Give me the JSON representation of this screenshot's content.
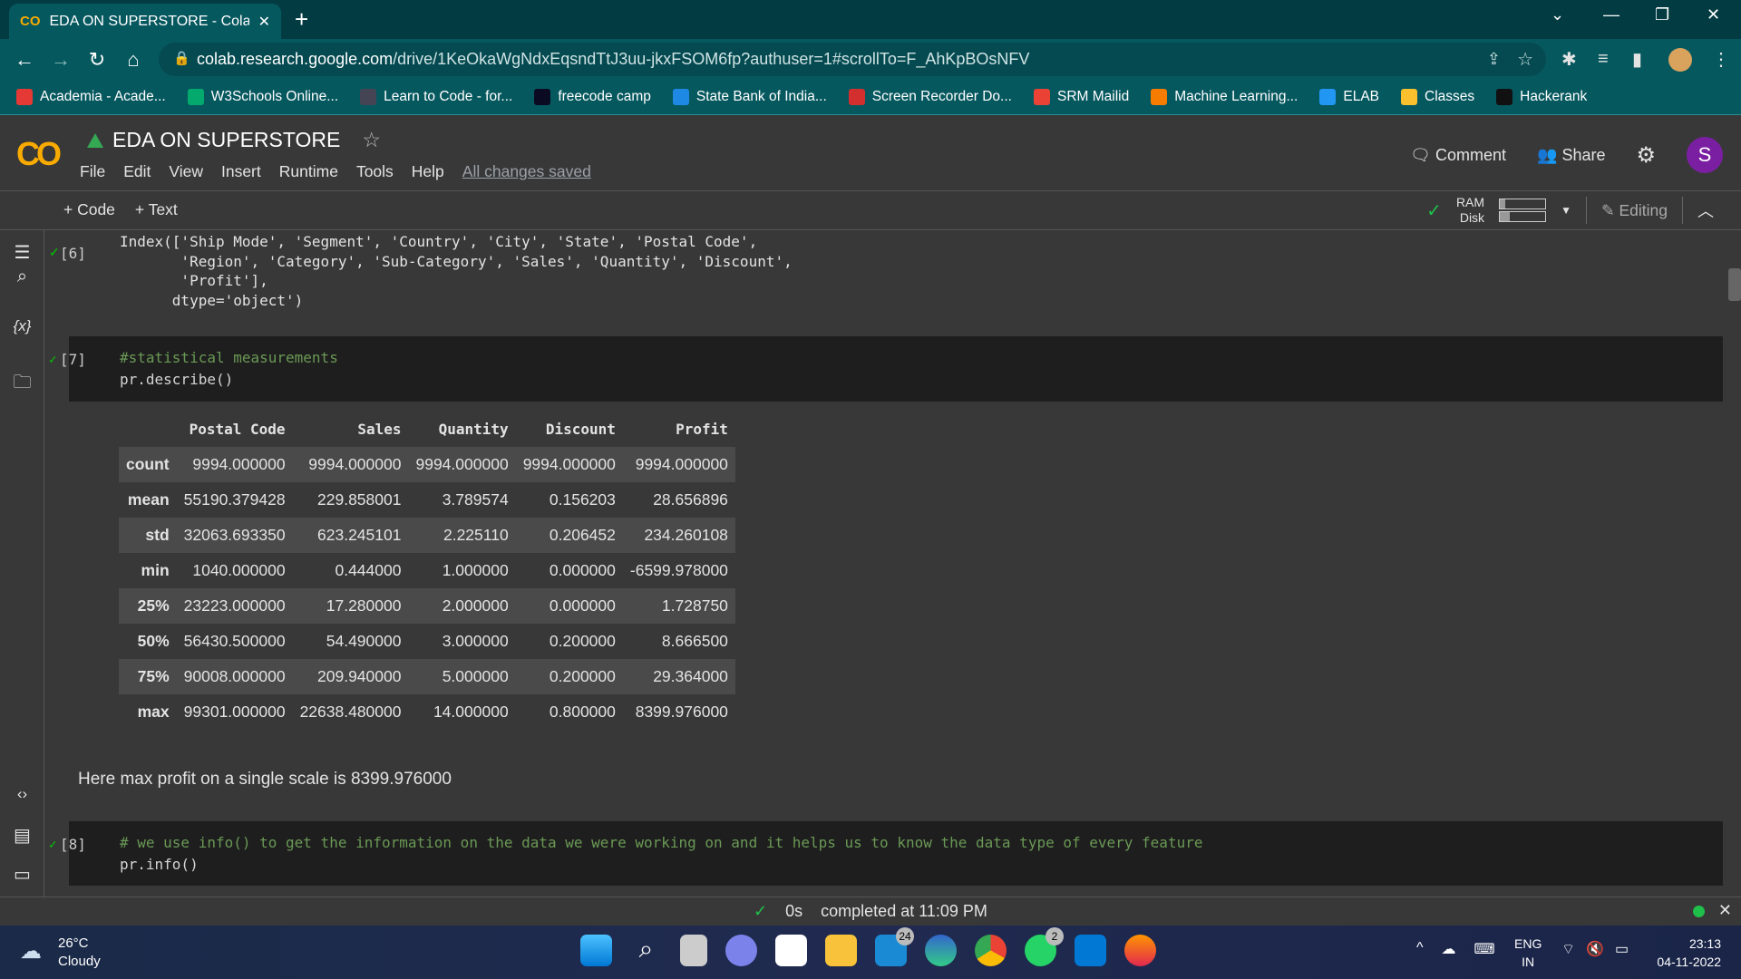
{
  "browser": {
    "tab_title": "EDA ON SUPERSTORE - Colaboratory",
    "url_host": "colab.research.google.com",
    "url_path": "/drive/1KeOkaWgNdxEqsndTtJ3uu-jkxFSOM6fp?authuser=1#scrollTo=F_AhKpBOsNFV",
    "bookmarks": [
      {
        "label": "Academia - Acade...",
        "color": "#e53935"
      },
      {
        "label": "W3Schools Online...",
        "color": "#04aa6d"
      },
      {
        "label": "Learn to Code - for...",
        "color": "#445"
      },
      {
        "label": "freecode camp",
        "color": "#0a0a23"
      },
      {
        "label": "State Bank of India...",
        "color": "#1e88e5"
      },
      {
        "label": "Screen Recorder Do...",
        "color": "#d32f2f"
      },
      {
        "label": "SRM Mailid",
        "color": "#ea4335"
      },
      {
        "label": "Machine Learning...",
        "color": "#f57c00"
      },
      {
        "label": "ELAB",
        "color": "#2196f3"
      },
      {
        "label": "Classes",
        "color": "#fbc02d"
      },
      {
        "label": "Hackerank",
        "color": "#111"
      }
    ]
  },
  "colab": {
    "logo": "CO",
    "title": "EDA ON SUPERSTORE",
    "menu": [
      "File",
      "Edit",
      "View",
      "Insert",
      "Runtime",
      "Tools",
      "Help"
    ],
    "saved": "All changes saved",
    "comment": "Comment",
    "share": "Share",
    "avatar": "S",
    "add_code": "+ Code",
    "add_text": "+ Text",
    "ram": "RAM",
    "disk": "Disk",
    "ram_usage": 0.12,
    "disk_usage": 0.22,
    "editing": "Editing",
    "accent": "#f9ab00"
  },
  "cells": {
    "c6": {
      "count": "[6]",
      "output": "Index(['Ship Mode', 'Segment', 'Country', 'City', 'State', 'Postal Code',\n       'Region', 'Category', 'Sub-Category', 'Sales', 'Quantity', 'Discount',\n       'Profit'],\n      dtype='object')"
    },
    "c7": {
      "count": "[7]",
      "comment": "#statistical measurements",
      "code": "pr.describe()"
    },
    "table": {
      "columns": [
        "",
        "Postal Code",
        "Sales",
        "Quantity",
        "Discount",
        "Profit"
      ],
      "rows": [
        [
          "count",
          "9994.000000",
          "9994.000000",
          "9994.000000",
          "9994.000000",
          "9994.000000"
        ],
        [
          "mean",
          "55190.379428",
          "229.858001",
          "3.789574",
          "0.156203",
          "28.656896"
        ],
        [
          "std",
          "32063.693350",
          "623.245101",
          "2.225110",
          "0.206452",
          "234.260108"
        ],
        [
          "min",
          "1040.000000",
          "0.444000",
          "1.000000",
          "0.000000",
          "-6599.978000"
        ],
        [
          "25%",
          "23223.000000",
          "17.280000",
          "2.000000",
          "0.000000",
          "1.728750"
        ],
        [
          "50%",
          "56430.500000",
          "54.490000",
          "3.000000",
          "0.200000",
          "8.666500"
        ],
        [
          "75%",
          "90008.000000",
          "209.940000",
          "5.000000",
          "0.200000",
          "29.364000"
        ],
        [
          "max",
          "99301.000000",
          "22638.480000",
          "14.000000",
          "0.800000",
          "8399.976000"
        ]
      ]
    },
    "text": "Here max profit on a single scale is 8399.976000",
    "c8": {
      "count": "[8]",
      "comment": "# we use info() to get the information on the data we were working on and it helps us to know the data type of every feature",
      "code": "pr.info()"
    }
  },
  "status": {
    "time": "0s",
    "completed": "completed at 11:09 PM"
  },
  "taskbar": {
    "temp": "26°C",
    "weather": "Cloudy",
    "lang1": "ENG",
    "lang2": "IN",
    "time": "23:13",
    "date": "04-11-2022",
    "mail_badge": "24",
    "whatsapp_badge": "2"
  }
}
